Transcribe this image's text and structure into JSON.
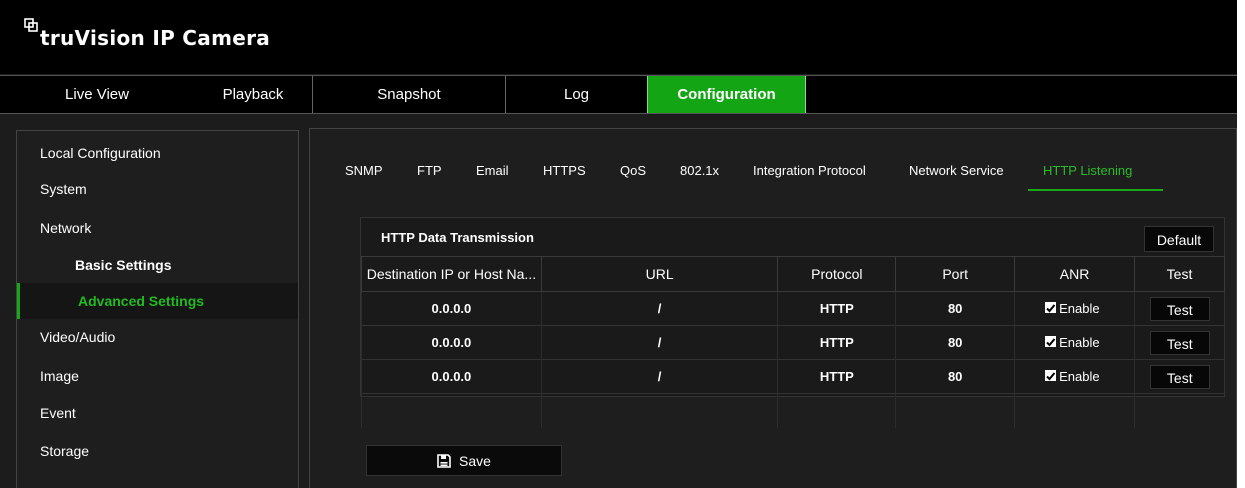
{
  "app": {
    "brand": "truVision  IP Camera"
  },
  "topnav": {
    "tabs": [
      {
        "label": "Live View"
      },
      {
        "label": "Playback"
      },
      {
        "label": "Snapshot"
      },
      {
        "label": "Log"
      },
      {
        "label": "Configuration",
        "active": true
      }
    ]
  },
  "sidebar": {
    "items": [
      {
        "label": "Local Configuration"
      },
      {
        "label": "System"
      },
      {
        "label": "Network"
      },
      {
        "label": "Basic Settings",
        "sub": true
      },
      {
        "label": "Advanced Settings",
        "sub": true,
        "active": true
      },
      {
        "label": "Video/Audio"
      },
      {
        "label": "Image"
      },
      {
        "label": "Event"
      },
      {
        "label": "Storage"
      }
    ]
  },
  "subtabs": [
    {
      "label": "SNMP"
    },
    {
      "label": "FTP"
    },
    {
      "label": "Email"
    },
    {
      "label": "HTTPS"
    },
    {
      "label": "QoS"
    },
    {
      "label": "802.1x"
    },
    {
      "label": "Integration Protocol"
    },
    {
      "label": "Network Service"
    },
    {
      "label": "HTTP Listening",
      "active": true
    }
  ],
  "panel": {
    "title": "HTTP Data Transmission",
    "default_label": "Default",
    "columns": [
      "Destination IP or Host Na...",
      "URL",
      "Protocol",
      "Port",
      "ANR",
      "Test"
    ],
    "rows": [
      {
        "ip": "0.0.0.0",
        "url": "/",
        "protocol": "HTTP",
        "port": "80",
        "anr": "Enable",
        "test": "Test"
      },
      {
        "ip": "0.0.0.0",
        "url": "/",
        "protocol": "HTTP",
        "port": "80",
        "anr": "Enable",
        "test": "Test"
      },
      {
        "ip": "0.0.0.0",
        "url": "/",
        "protocol": "HTTP",
        "port": "80",
        "anr": "Enable",
        "test": "Test"
      }
    ]
  },
  "save_label": "Save",
  "icons": {
    "logo": "camera-logo-icon",
    "save": "floppy-disk-icon",
    "checkbox": "checkbox-checked-icon"
  },
  "colors": {
    "accent": "#14a514",
    "active_text": "#2bbb2b"
  }
}
